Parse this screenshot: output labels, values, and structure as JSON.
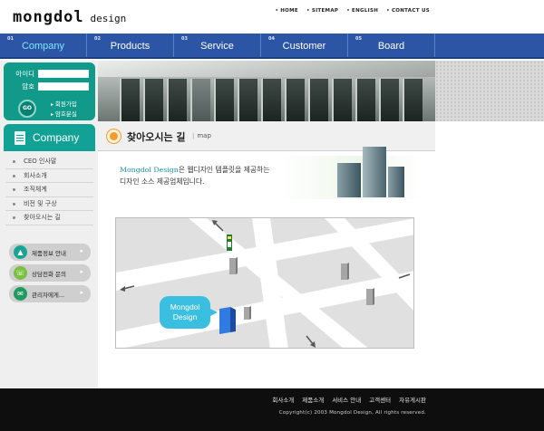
{
  "header": {
    "logo_brand": "mongdol",
    "logo_design": "design",
    "util_links": [
      "HOME",
      "SITEMAP",
      "ENGLISH",
      "CONTACT US"
    ]
  },
  "nav": [
    {
      "num": "01",
      "label": "Company",
      "active": true
    },
    {
      "num": "02",
      "label": "Products",
      "active": false
    },
    {
      "num": "03",
      "label": "Service",
      "active": false
    },
    {
      "num": "04",
      "label": "Customer",
      "active": false
    },
    {
      "num": "05",
      "label": "Board",
      "active": false
    }
  ],
  "login": {
    "id_label": "아이디",
    "pw_label": "암호",
    "go_label": "GO",
    "join_link": "회원가입",
    "find_link": "암호분실"
  },
  "sidebar": {
    "section_title": "Company",
    "items": [
      "CEO 인사말",
      "회사소개",
      "조직체계",
      "비전 및 구상",
      "찾아오시는 길"
    ],
    "quick": [
      {
        "icon": "triangle-icon",
        "label": "제품정보 안내"
      },
      {
        "icon": "phone-icon",
        "label": "상담전화 문의"
      },
      {
        "icon": "mail-icon",
        "label": "관리자에게..."
      }
    ]
  },
  "page": {
    "title": "찾아오시는 길",
    "subtitle": "map",
    "intro_company": "Mongdol Design",
    "intro_line1_rest": "은 웹디자인 템플릿을 제공하는",
    "intro_line2": "디자인 소스 제공업체입니다."
  },
  "map": {
    "bubble_line1": "Mongdol",
    "bubble_line2": "Design"
  },
  "footer": {
    "links": [
      "회사소개",
      "제품소개",
      "서비스 안내",
      "고객센터",
      "자유게시판"
    ],
    "copyright": "Copyright(c) 2003 Mongdol Design, All rights reserved."
  },
  "colors": {
    "nav_bg": "#2c55a5",
    "nav_active": "#7fe9ff",
    "teal": "#11a195",
    "orange": "#f19c2b",
    "footer_bg": "#0e0e0e",
    "map_bubble": "#3bbfe0"
  }
}
